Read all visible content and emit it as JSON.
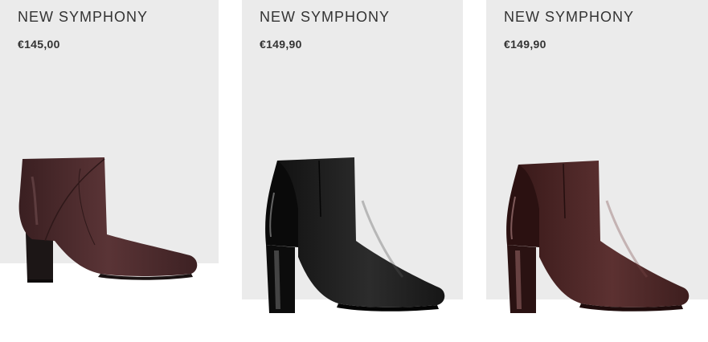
{
  "products": [
    {
      "name": "NEW SYMPHONY",
      "price": "€145,00",
      "image": "burgundy-leather-block-heel-ankle-boot",
      "color": "#4a2a2b"
    },
    {
      "name": "NEW SYMPHONY",
      "price": "€149,90",
      "image": "black-leather-patent-heel-ankle-boot",
      "color": "#1e1e1e"
    },
    {
      "name": "NEW SYMPHONY",
      "price": "€149,90",
      "image": "burgundy-leather-patent-heel-ankle-boot",
      "color": "#4b2525"
    }
  ]
}
